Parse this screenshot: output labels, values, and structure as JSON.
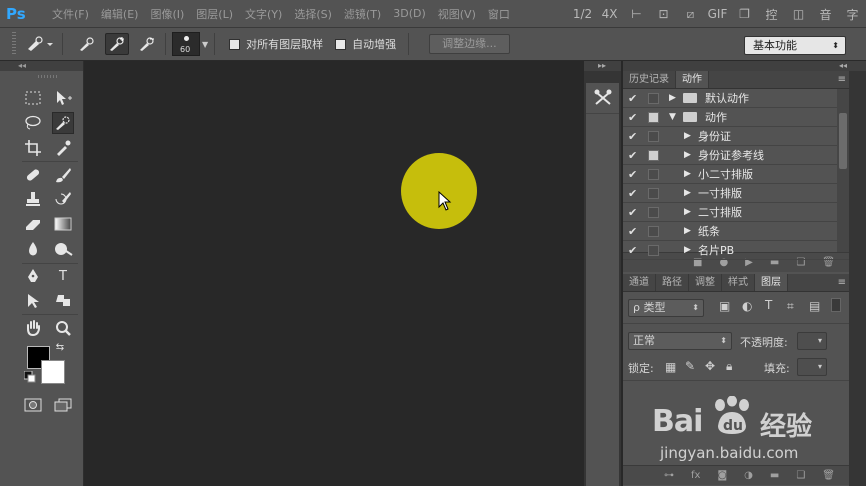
{
  "menubar": {
    "logo": "Ps",
    "items": [
      "文件(F)",
      "编辑(E)",
      "图像(I)",
      "图层(L)",
      "文字(Y)",
      "选择(S)",
      "滤镜(T)",
      "3D(D)",
      "视图(V)",
      "窗口"
    ],
    "overlay_controls": [
      "1/2",
      "4X",
      "GIF",
      "控",
      "音",
      "字"
    ]
  },
  "options": {
    "brush_size": "60",
    "sample_all_layers": "对所有图层取样",
    "auto_enhance": "自动增强",
    "refine_edge": "调整边缘...",
    "workspace": "基本功能"
  },
  "panels": {
    "top_tabs": [
      "历史记录",
      "动作"
    ],
    "actions": [
      {
        "label": "默认动作",
        "toggle": false,
        "type": "set",
        "expanded": false
      },
      {
        "label": "动作",
        "toggle": true,
        "type": "set",
        "expanded": true
      },
      {
        "label": "身份证",
        "toggle": false,
        "type": "action"
      },
      {
        "label": "身份证参考线",
        "toggle": true,
        "type": "action"
      },
      {
        "label": "小二寸排版",
        "toggle": false,
        "type": "action"
      },
      {
        "label": "一寸排版",
        "toggle": false,
        "type": "action"
      },
      {
        "label": "二寸排版",
        "toggle": false,
        "type": "action"
      },
      {
        "label": "纸条",
        "toggle": false,
        "type": "action"
      },
      {
        "label": "名片PB",
        "toggle": false,
        "type": "action"
      }
    ],
    "layer_tabs": [
      "通道",
      "路径",
      "调整",
      "样式",
      "图层"
    ],
    "filter_kind": "ρ 类型",
    "blend_mode": "正常",
    "opacity_label": "不透明度:",
    "lock_label": "锁定:",
    "fill_label": "填充:"
  },
  "watermark": {
    "brand": "Bai",
    "brand_cn": "经验",
    "url": "jingyan.baidu.com"
  },
  "canvas": {
    "dot_color": "#c6be0c"
  }
}
